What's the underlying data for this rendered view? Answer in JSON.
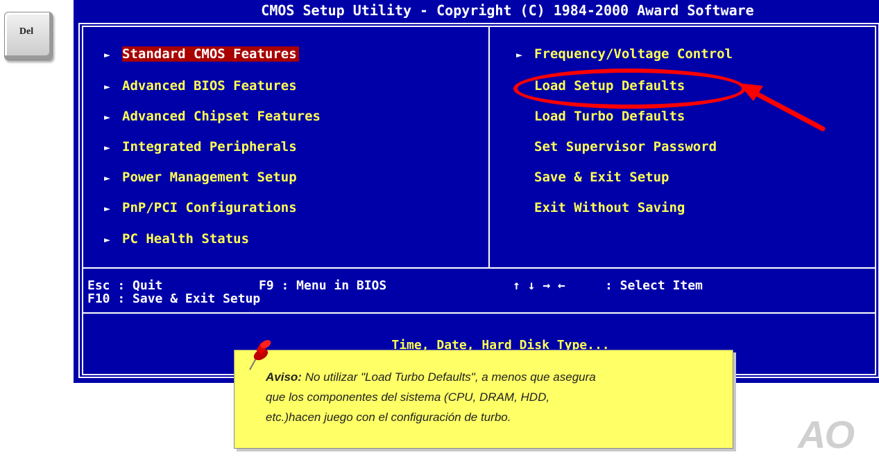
{
  "key": {
    "label": "Del"
  },
  "bios": {
    "title": "CMOS Setup Utility - Copyright (C) 1984-2000 Award Software",
    "left_menu": [
      {
        "label": "Standard CMOS Features",
        "arrow": "►",
        "selected": true
      },
      {
        "label": "Advanced BIOS Features",
        "arrow": "►"
      },
      {
        "label": "Advanced Chipset Features",
        "arrow": "►"
      },
      {
        "label": "Integrated Peripherals",
        "arrow": "►"
      },
      {
        "label": "Power Management Setup",
        "arrow": "►"
      },
      {
        "label": "PnP/PCI Configurations",
        "arrow": "►"
      },
      {
        "label": "PC Health Status",
        "arrow": "►"
      }
    ],
    "right_menu": [
      {
        "label": "Frequency/Voltage Control",
        "arrow": "►"
      },
      {
        "label": "Load Setup Defaults"
      },
      {
        "label": "Load Turbo Defaults"
      },
      {
        "label": "Set Supervisor Password"
      },
      {
        "label": "Save & Exit Setup"
      },
      {
        "label": "Exit Without Saving"
      }
    ],
    "help": {
      "esc": "Esc : Quit",
      "f9": "F9 : Menu in BIOS",
      "arrows": "↑ ↓ → ←",
      "select": ": Select Item",
      "f10": "F10 : Save & Exit Setup"
    },
    "description": "Time, Date, Hard Disk Type..."
  },
  "note": {
    "heading": "Aviso:",
    "line1": " No utilizar \"Load Turbo Defaults\", a menos que asegura",
    "line2": "que los componentes del sistema (CPU, DRAM, HDD,",
    "line3": "etc.)hacen juego con el configuración de turbo."
  },
  "logo": {
    "text": "AO"
  },
  "colors": {
    "bios_background": "#0000a8",
    "menu_text": "#ffff55",
    "selection": "#a80000",
    "annotation": "#ff0000",
    "note_background": "#ffff66"
  }
}
